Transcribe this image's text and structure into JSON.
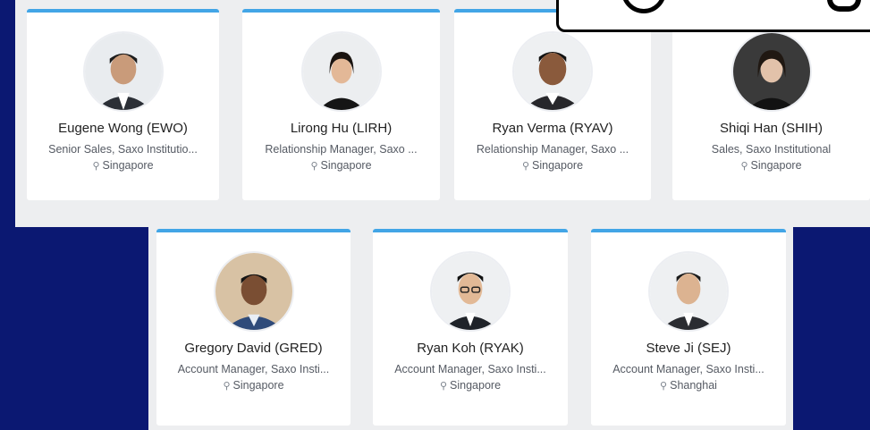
{
  "colors": {
    "background": "#0b1872",
    "panel": "#edeef0",
    "card": "#ffffff",
    "accent": "#42a5e6"
  },
  "contacts": [
    {
      "name": "Eugene Wong (EWO)",
      "role": "Senior Sales, Saxo Institutio...",
      "location": "Singapore",
      "icon": "map-pin-icon"
    },
    {
      "name": "Lirong Hu (LIRH)",
      "role": "Relationship Manager, Saxo ...",
      "location": "Singapore",
      "icon": "map-pin-icon"
    },
    {
      "name": "Ryan Verma (RYAV)",
      "role": "Relationship Manager, Saxo ...",
      "location": "Singapore",
      "icon": "map-pin-icon"
    },
    {
      "name": "Shiqi Han (SHIH)",
      "role": "Sales, Saxo Institutional",
      "location": "Singapore",
      "icon": "map-pin-icon"
    },
    {
      "name": "Gregory David (GRED)",
      "role": "Account Manager, Saxo Insti...",
      "location": "Singapore",
      "icon": "map-pin-icon"
    },
    {
      "name": "Ryan Koh (RYAK)",
      "role": "Account Manager, Saxo Insti...",
      "location": "Singapore",
      "icon": "map-pin-icon"
    },
    {
      "name": "Steve Ji (SEJ)",
      "role": "Account Manager, Saxo Insti...",
      "location": "Shanghai",
      "icon": "map-pin-icon"
    }
  ]
}
